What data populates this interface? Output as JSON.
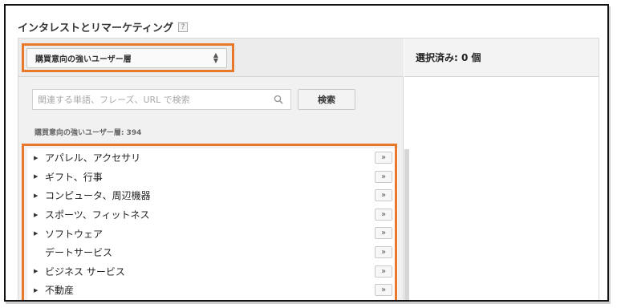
{
  "heading": {
    "title": "インタレストとリマーケティング",
    "help": "?"
  },
  "selector": {
    "value": "購買意向の強いユーザー層"
  },
  "selected": {
    "label": "選択済み: 0 個"
  },
  "search": {
    "placeholder": "関連する単語、フレーズ、URL で検索",
    "button_label": "検索"
  },
  "count_label": "購買意向の強いユーザー層: 394",
  "list": {
    "add_label": "»",
    "items": [
      {
        "label": "アパレル、アクセサリ",
        "caret": "▶"
      },
      {
        "label": "ギフト、行事",
        "caret": "▶"
      },
      {
        "label": "コンピュータ、周辺機器",
        "caret": "▶"
      },
      {
        "label": "スポーツ、フィットネス",
        "caret": "▶"
      },
      {
        "label": "ソフトウェア",
        "caret": "▶"
      },
      {
        "label": "デートサービス",
        "caret": ""
      },
      {
        "label": "ビジネス サービス",
        "caret": "▶"
      },
      {
        "label": "不動産",
        "caret": "▶"
      }
    ]
  },
  "colors": {
    "highlight": "#e8782a"
  }
}
